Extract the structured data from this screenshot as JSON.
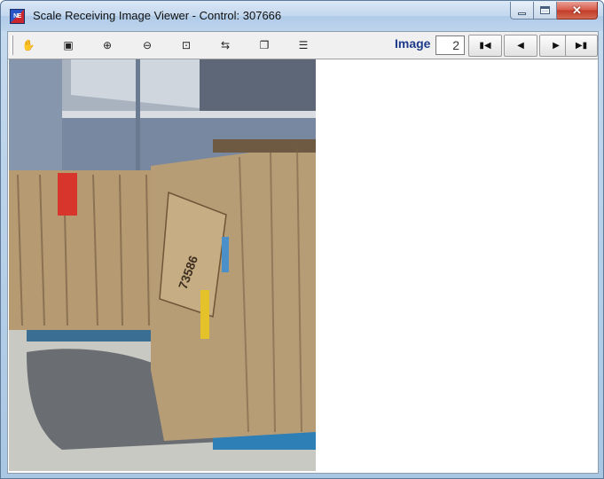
{
  "window": {
    "title": "Scale Receiving Image Viewer - Control: 307666",
    "icon_text": "NE"
  },
  "toolbar": {
    "tools": [
      {
        "name": "pan-tool",
        "icon": "hand-icon",
        "glyph": "✋"
      },
      {
        "name": "fit-image",
        "icon": "picture-icon",
        "glyph": "▣"
      },
      {
        "name": "zoom-in",
        "icon": "zoom-in-icon",
        "glyph": "⊕"
      },
      {
        "name": "zoom-out",
        "icon": "zoom-out-icon",
        "glyph": "⊖"
      },
      {
        "name": "crop",
        "icon": "crop-icon",
        "glyph": "⊡"
      },
      {
        "name": "fit-width",
        "icon": "fit-width-icon",
        "glyph": "⇆"
      },
      {
        "name": "copy",
        "icon": "copy-icon",
        "glyph": "❐"
      },
      {
        "name": "fit-height",
        "icon": "fit-height-icon",
        "glyph": "☰"
      }
    ],
    "image_label": "Image",
    "image_number": "2",
    "nav": [
      {
        "name": "first-image",
        "icon": "first-icon",
        "glyph": "▮◀"
      },
      {
        "name": "previous-image",
        "icon": "previous-icon",
        "glyph": "◀"
      },
      {
        "name": "next-image",
        "icon": "next-icon",
        "glyph": "▶"
      },
      {
        "name": "last-image",
        "icon": "last-icon",
        "glyph": "▶▮"
      }
    ]
  },
  "viewer": {
    "photo_subject": "cardboard-bales-photo"
  },
  "colors": {
    "titlebar": "#c2d7ee",
    "close_button": "#c23a28",
    "image_label": "#1e3a8a"
  }
}
